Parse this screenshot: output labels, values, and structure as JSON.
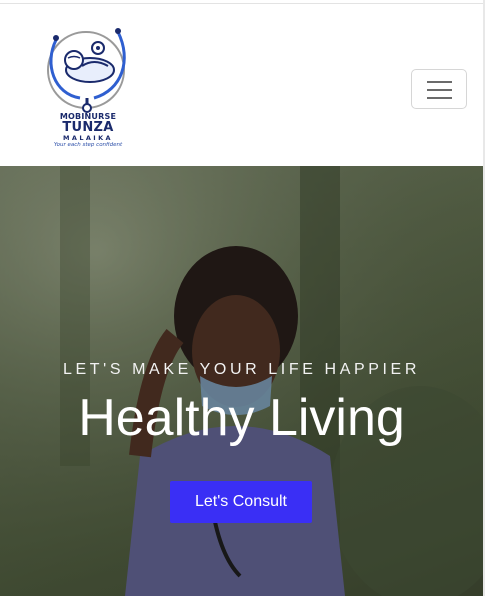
{
  "brand": {
    "line1": "MOBINURSE",
    "line2": "TUNZA",
    "line3": "MALAIKA",
    "tagline": "Your each step confident"
  },
  "navbar": {
    "toggler_icon": "hamburger-menu-icon"
  },
  "hero": {
    "subtitle": "LET'S MAKE YOUR LIFE HAPPIER",
    "title": "Healthy Living",
    "cta_label": "Let's Consult"
  },
  "colors": {
    "brand_navy": "#1a2a6c",
    "cta_blue": "#3a2ff5"
  }
}
